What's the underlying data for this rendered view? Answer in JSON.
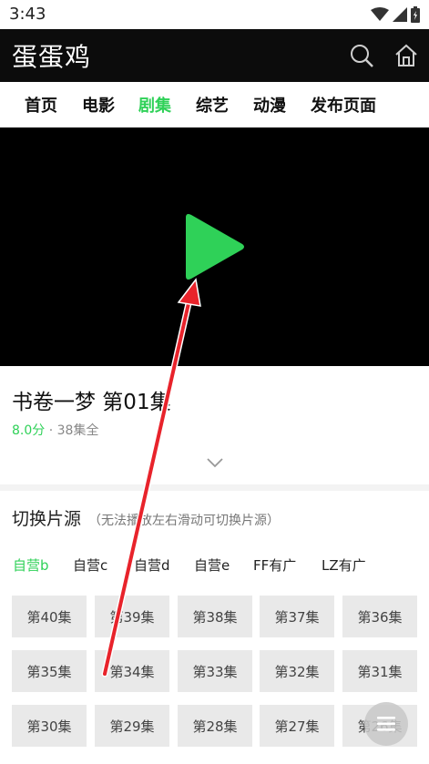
{
  "status_bar": {
    "time": "3:43",
    "icons": [
      "wifi-icon",
      "signal-icon",
      "battery-icon"
    ]
  },
  "header": {
    "title": "蛋蛋鸡",
    "search_icon": "search-icon",
    "home_icon": "home-icon"
  },
  "nav": {
    "items": [
      {
        "label": "首页",
        "active": false
      },
      {
        "label": "电影",
        "active": false
      },
      {
        "label": "剧集",
        "active": true
      },
      {
        "label": "综艺",
        "active": false
      },
      {
        "label": "动漫",
        "active": false
      },
      {
        "label": "发布页面",
        "active": false
      }
    ]
  },
  "player": {
    "play_icon": "play-icon"
  },
  "show": {
    "title": "书卷一梦 第01集",
    "rating": "8.0分",
    "separator": " · ",
    "episodes_total": "38集全"
  },
  "source": {
    "title": "切换片源",
    "hint": "（无法播放左右滑动可切换片源）",
    "tabs": [
      {
        "label": "自营b",
        "active": true
      },
      {
        "label": "自营c",
        "active": false
      },
      {
        "label": "自营d",
        "active": false
      },
      {
        "label": "自营e",
        "active": false
      },
      {
        "label": "FF有广",
        "active": false
      },
      {
        "label": "LZ有广",
        "active": false
      }
    ]
  },
  "episodes": [
    "第40集",
    "第39集",
    "第38集",
    "第37集",
    "第36集",
    "第35集",
    "第34集",
    "第33集",
    "第32集",
    "第31集",
    "第30集",
    "第29集",
    "第28集",
    "第27集",
    "第26集"
  ],
  "colors": {
    "accent": "#2fd158",
    "header_bg": "#0c0c0c",
    "annotation": "#e8232b"
  }
}
